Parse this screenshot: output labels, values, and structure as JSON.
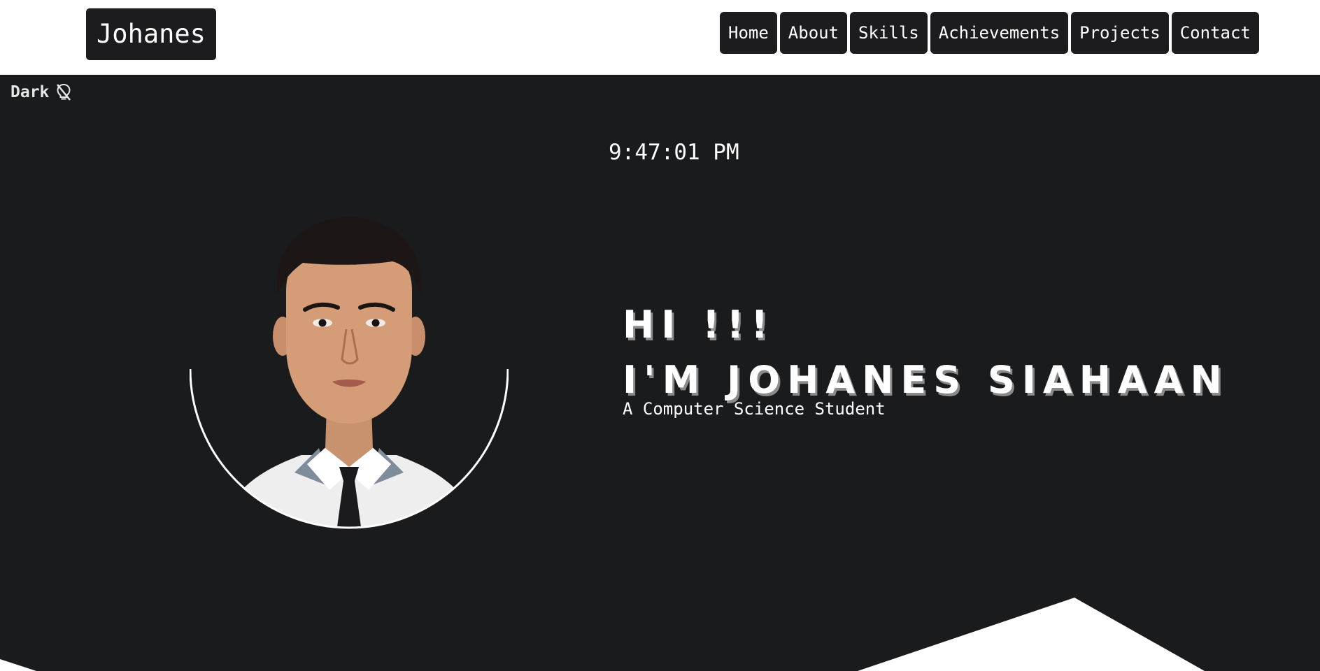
{
  "navbar": {
    "brand": "Johanes",
    "links": [
      "Home",
      "About",
      "Skills",
      "Achievements",
      "Projects",
      "Contact"
    ]
  },
  "hero": {
    "theme_label": "Dark",
    "theme_icon": "lightbulb-off-icon",
    "clock": "9:47:01 PM",
    "greeting": "HI !!!",
    "name_line": "I'M JOHANES SIAHAAN",
    "subtitle": "A Computer Science Student"
  },
  "colors": {
    "navbar_bg": "#ffffff",
    "button_bg": "#1c1c1e",
    "hero_bg": "#1a1b1d",
    "text": "#ffffff",
    "headline_shadow": "#8a8a8a"
  }
}
